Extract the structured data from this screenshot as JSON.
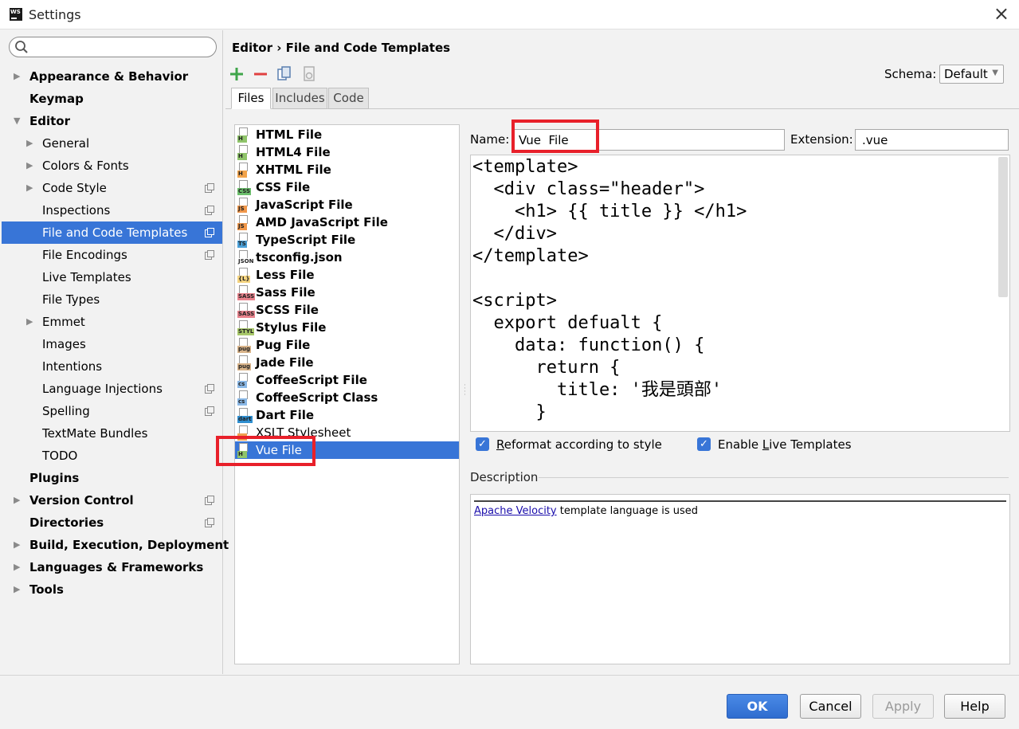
{
  "window": {
    "title": "Settings",
    "app_icon": "WS",
    "close": "×"
  },
  "search": {
    "value": "",
    "placeholder": ""
  },
  "tree": [
    {
      "label": "Appearance & Behavior",
      "bold": true,
      "arrow": "right",
      "level": 0
    },
    {
      "label": "Keymap",
      "bold": true,
      "arrow": "",
      "level": 0
    },
    {
      "label": "Editor",
      "bold": true,
      "arrow": "down",
      "level": 0
    },
    {
      "label": "General",
      "bold": false,
      "arrow": "right",
      "level": 1
    },
    {
      "label": "Colors & Fonts",
      "bold": false,
      "arrow": "right",
      "level": 1
    },
    {
      "label": "Code Style",
      "bold": false,
      "arrow": "right",
      "level": 1,
      "project_icon": true
    },
    {
      "label": "Inspections",
      "bold": false,
      "arrow": "",
      "level": 1,
      "project_icon": true
    },
    {
      "label": "File and Code Templates",
      "bold": false,
      "arrow": "",
      "level": 1,
      "project_icon": true,
      "selected": true
    },
    {
      "label": "File Encodings",
      "bold": false,
      "arrow": "",
      "level": 1,
      "project_icon": true
    },
    {
      "label": "Live Templates",
      "bold": false,
      "arrow": "",
      "level": 1
    },
    {
      "label": "File Types",
      "bold": false,
      "arrow": "",
      "level": 1
    },
    {
      "label": "Emmet",
      "bold": false,
      "arrow": "right",
      "level": 1
    },
    {
      "label": "Images",
      "bold": false,
      "arrow": "",
      "level": 1
    },
    {
      "label": "Intentions",
      "bold": false,
      "arrow": "",
      "level": 1
    },
    {
      "label": "Language Injections",
      "bold": false,
      "arrow": "",
      "level": 1,
      "project_icon": true
    },
    {
      "label": "Spelling",
      "bold": false,
      "arrow": "",
      "level": 1,
      "project_icon": true
    },
    {
      "label": "TextMate Bundles",
      "bold": false,
      "arrow": "",
      "level": 1
    },
    {
      "label": "TODO",
      "bold": false,
      "arrow": "",
      "level": 1
    },
    {
      "label": "Plugins",
      "bold": true,
      "arrow": "",
      "level": 0
    },
    {
      "label": "Version Control",
      "bold": true,
      "arrow": "right",
      "level": 0,
      "project_icon": true
    },
    {
      "label": "Directories",
      "bold": true,
      "arrow": "",
      "level": 0,
      "project_icon": true
    },
    {
      "label": "Build, Execution, Deployment",
      "bold": true,
      "arrow": "right",
      "level": 0
    },
    {
      "label": "Languages & Frameworks",
      "bold": true,
      "arrow": "right",
      "level": 0
    },
    {
      "label": "Tools",
      "bold": true,
      "arrow": "right",
      "level": 0
    }
  ],
  "breadcrumb": "Editor › File and Code Templates",
  "toolbar": [
    {
      "name": "add-icon",
      "color": "#3fa54a"
    },
    {
      "name": "remove-icon",
      "color": "#e04040"
    },
    {
      "name": "copy-icon",
      "color": "#5a7fb0"
    },
    {
      "name": "reset-icon",
      "color": "#b0b0b0"
    }
  ],
  "schema": {
    "label": "Schema:",
    "value": "Default"
  },
  "tabs": [
    {
      "label": "Files",
      "active": true
    },
    {
      "label": "Includes",
      "active": false
    },
    {
      "label": "Code",
      "active": false
    }
  ],
  "files": [
    {
      "label": "HTML File",
      "badge": "H",
      "color": "#8fc46a"
    },
    {
      "label": "HTML4 File",
      "badge": "H",
      "color": "#8fc46a"
    },
    {
      "label": "XHTML File",
      "badge": "H",
      "color": "#f2a34a"
    },
    {
      "label": "CSS File",
      "badge": "CSS",
      "color": "#6cbf6c"
    },
    {
      "label": "JavaScript File",
      "badge": "JS",
      "color": "#f0974a"
    },
    {
      "label": "AMD JavaScript File",
      "badge": "JS",
      "color": "#f0974a"
    },
    {
      "label": "TypeScript File",
      "badge": "TS",
      "color": "#4aa0d8"
    },
    {
      "label": "tsconfig.json",
      "badge": "JSON",
      "color": "#ffffff"
    },
    {
      "label": "Less File",
      "badge": "{L}",
      "color": "#f5d480"
    },
    {
      "label": "Sass File",
      "badge": "SASS",
      "color": "#e8828c"
    },
    {
      "label": "SCSS File",
      "badge": "SASS",
      "color": "#e8828c"
    },
    {
      "label": "Stylus File",
      "badge": "STYL",
      "color": "#a8c86a"
    },
    {
      "label": "Pug File",
      "badge": "pug",
      "color": "#d9b48a"
    },
    {
      "label": "Jade File",
      "badge": "pug",
      "color": "#d9b48a"
    },
    {
      "label": "CoffeeScript File",
      "badge": "cs",
      "color": "#8ab8e6"
    },
    {
      "label": "CoffeeScript Class",
      "badge": "cs",
      "color": "#8ab8e6"
    },
    {
      "label": "Dart File",
      "badge": "dart",
      "color": "#2f8fd0"
    },
    {
      "label": "XSLT Stylesheet",
      "badge": "",
      "color": "#f0a050",
      "plain": true
    },
    {
      "label": "Vue  File",
      "badge": "H",
      "color": "#8fc46a",
      "selected": true
    }
  ],
  "name_field": {
    "label": "Name:",
    "value": "Vue  File"
  },
  "extension_field": {
    "label": "Extension:",
    "value": ".vue"
  },
  "code": [
    "<template>",
    "  <div class=\"header\">",
    "    <h1> {{ title }} </h1>",
    "  </div>",
    "</template>",
    "",
    "<script>",
    "  export defualt {",
    "    data: function() {",
    "      return {",
    "        title: '我是頭部'",
    "      }"
  ],
  "checkboxes": {
    "reformat": {
      "pre": "",
      "u": "R",
      "post": "eformat according to style",
      "checked": true
    },
    "live": {
      "pre": "Enable ",
      "u": "L",
      "post": "ive Templates",
      "checked": true
    }
  },
  "description": {
    "label": "Description",
    "link": "Apache Velocity",
    "text": " template language is used"
  },
  "buttons": {
    "ok": "OK",
    "cancel": "Cancel",
    "apply": "Apply",
    "help": "Help"
  },
  "highlight_color": "#e8202a",
  "selection_color": "#3875d7"
}
